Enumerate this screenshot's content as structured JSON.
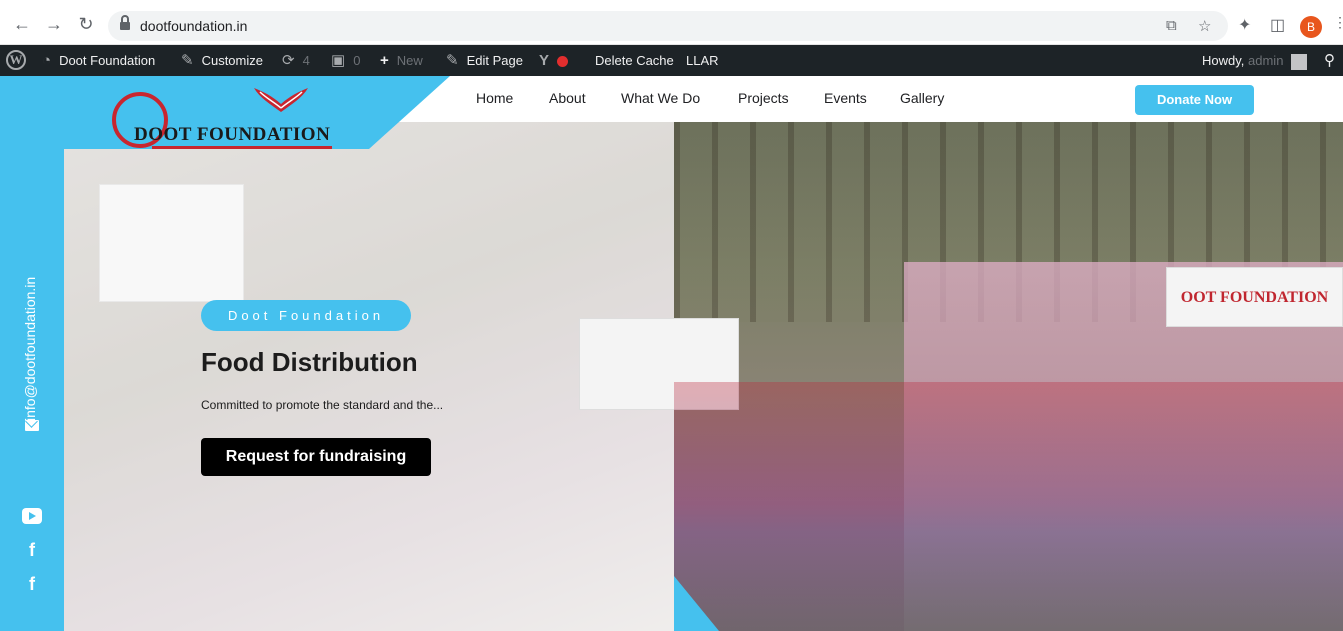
{
  "browser": {
    "url": "dootfoundation.in",
    "back_icon": "arrow-left-icon",
    "forward_icon": "arrow-right-icon",
    "reload_icon": "reload-icon",
    "profile_initial": "B",
    "profile_color": "#e8561d"
  },
  "adminbar": {
    "site_name": "Doot Foundation",
    "customize": "Customize",
    "updates_count": "4",
    "comments_count": "0",
    "new_label": "New",
    "edit_page": "Edit Page",
    "delete_cache": "Delete Cache",
    "llar": "LLAR",
    "howdy": "Howdy,",
    "user": "admin"
  },
  "site": {
    "logo_text": "DOOT FOUNDATION",
    "menu": [
      "Home",
      "About",
      "What We Do",
      "Projects",
      "Events",
      "Gallery"
    ],
    "donate": "Donate Now",
    "email": "info@dootfoundation.in",
    "accent": "#45c1ee"
  },
  "hero": {
    "tag": "Doot Foundation",
    "title": "Food Distribution",
    "subtitle": "Committed to promote the standard and the...",
    "cta": "Request for fundraising",
    "sign_text": "OOT FOUNDATION"
  }
}
